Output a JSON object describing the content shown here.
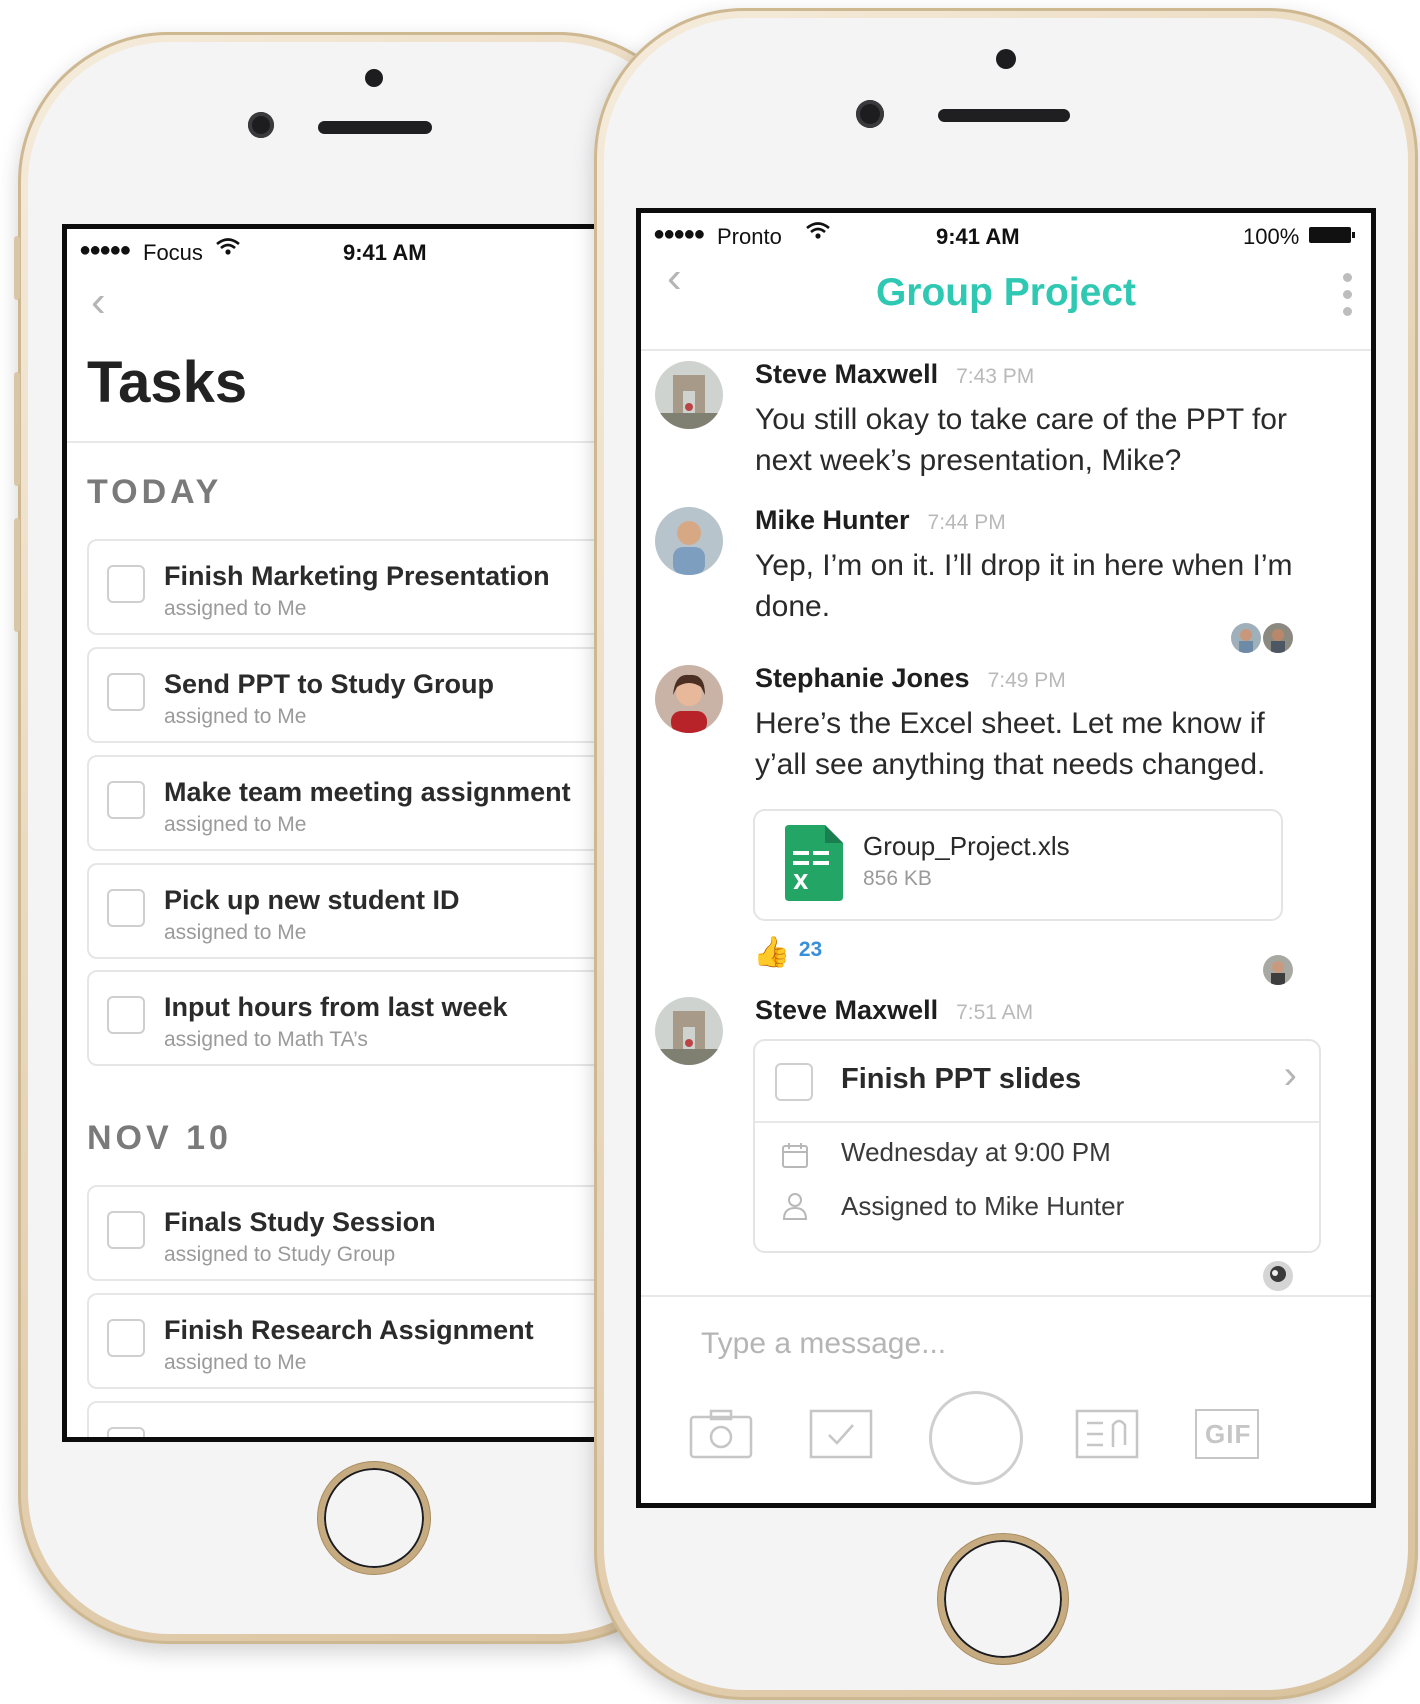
{
  "tasks_phone": {
    "status": {
      "signal": "●●●●●",
      "carrier": "Focus",
      "time": "9:41 AM"
    },
    "title": "Tasks",
    "sections": [
      {
        "heading": "TODAY",
        "items": [
          {
            "title": "Finish Marketing Presentation",
            "assignee": "assigned to Me"
          },
          {
            "title": "Send PPT to Study Group",
            "assignee": "assigned to Me"
          },
          {
            "title": "Make team meeting assignment",
            "assignee": "assigned to Me"
          },
          {
            "title": "Pick up new student ID",
            "assignee": "assigned to Me"
          },
          {
            "title": "Input hours from last week",
            "assignee": "assigned to Math TA’s"
          }
        ]
      },
      {
        "heading": "NOV 10",
        "items": [
          {
            "title": "Finals Study Session",
            "assignee": "assigned to Study Group"
          },
          {
            "title": "Finish Research Assignment",
            "assignee": "assigned to Me"
          }
        ]
      }
    ]
  },
  "chat_phone": {
    "status": {
      "signal": "●●●●●",
      "carrier": "Pronto",
      "time": "9:41 AM",
      "battery": "100%"
    },
    "title": "Group Project",
    "messages": [
      {
        "sender": "Steve Maxwell",
        "time": "7:43 PM",
        "text": "You still okay to take care of the PPT for next week’s presentation, Mike?"
      },
      {
        "sender": "Mike Hunter",
        "time": "7:44 PM",
        "text": "Yep, I’m on it. I’ll drop it in here when I’m done."
      },
      {
        "sender": "Stephanie Jones",
        "time": "7:49 PM",
        "text": "Here’s the Excel sheet. Let me know if y’all see anything that needs changed."
      },
      {
        "sender": "Steve Maxwell",
        "time": "7:51 AM"
      }
    ],
    "attachment": {
      "name": "Group_Project.xls",
      "size": "856 KB"
    },
    "reaction": {
      "emoji": "👍",
      "count": "23"
    },
    "task": {
      "title": "Finish PPT slides",
      "due": "Wednesday at 9:00 PM",
      "assignee": "Assigned to Mike Hunter"
    },
    "composer": {
      "placeholder": "Type a message..."
    },
    "toolbar": {
      "gif_label": "GIF"
    },
    "colors": {
      "accent": "#2fc9b3",
      "sheets_green": "#23a566",
      "reaction_blue": "#3a8fd9"
    }
  }
}
